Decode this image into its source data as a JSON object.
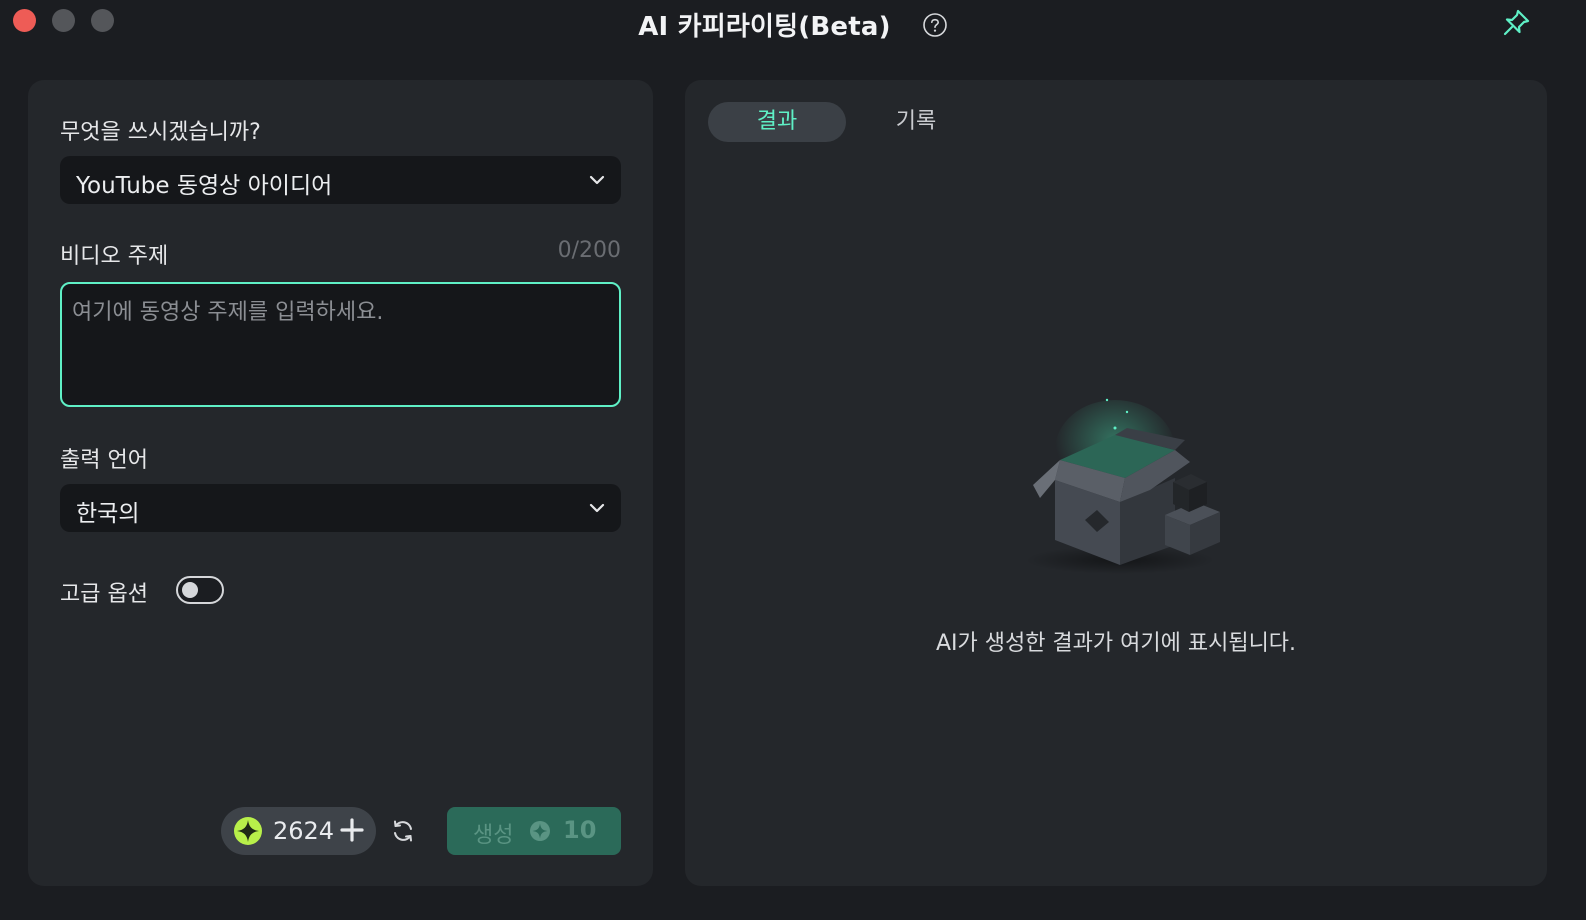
{
  "window": {
    "title": "AI 카피라이팅(Beta)",
    "icons": {
      "help": "help-circle-icon",
      "pin": "pin-icon"
    }
  },
  "form": {
    "what_label": "무엇을 쓰시겠습니까?",
    "what_value": "YouTube 동영상 아이디어",
    "topic_label": "비디오 주제",
    "topic_counter": "0/200",
    "topic_placeholder": "여기에 동영상 주제를 입력하세요.",
    "language_label": "출력 언어",
    "language_value": "한국의",
    "advanced_label": "고급 옵션",
    "advanced_on": false
  },
  "footer": {
    "credits": "2624",
    "generate_label": "생성",
    "generate_cost": "10"
  },
  "results": {
    "tabs": [
      {
        "label": "결과",
        "active": true
      },
      {
        "label": "기록",
        "active": false
      }
    ],
    "empty_message": "AI가 생성한 결과가 여기에 표시됩니다."
  },
  "colors": {
    "accent": "#5ff0c6",
    "background": "#1b1d21",
    "panel": "#24272b",
    "input": "#15171a",
    "generate_disabled": "#2b6a59",
    "coin": "#b8f04a"
  }
}
